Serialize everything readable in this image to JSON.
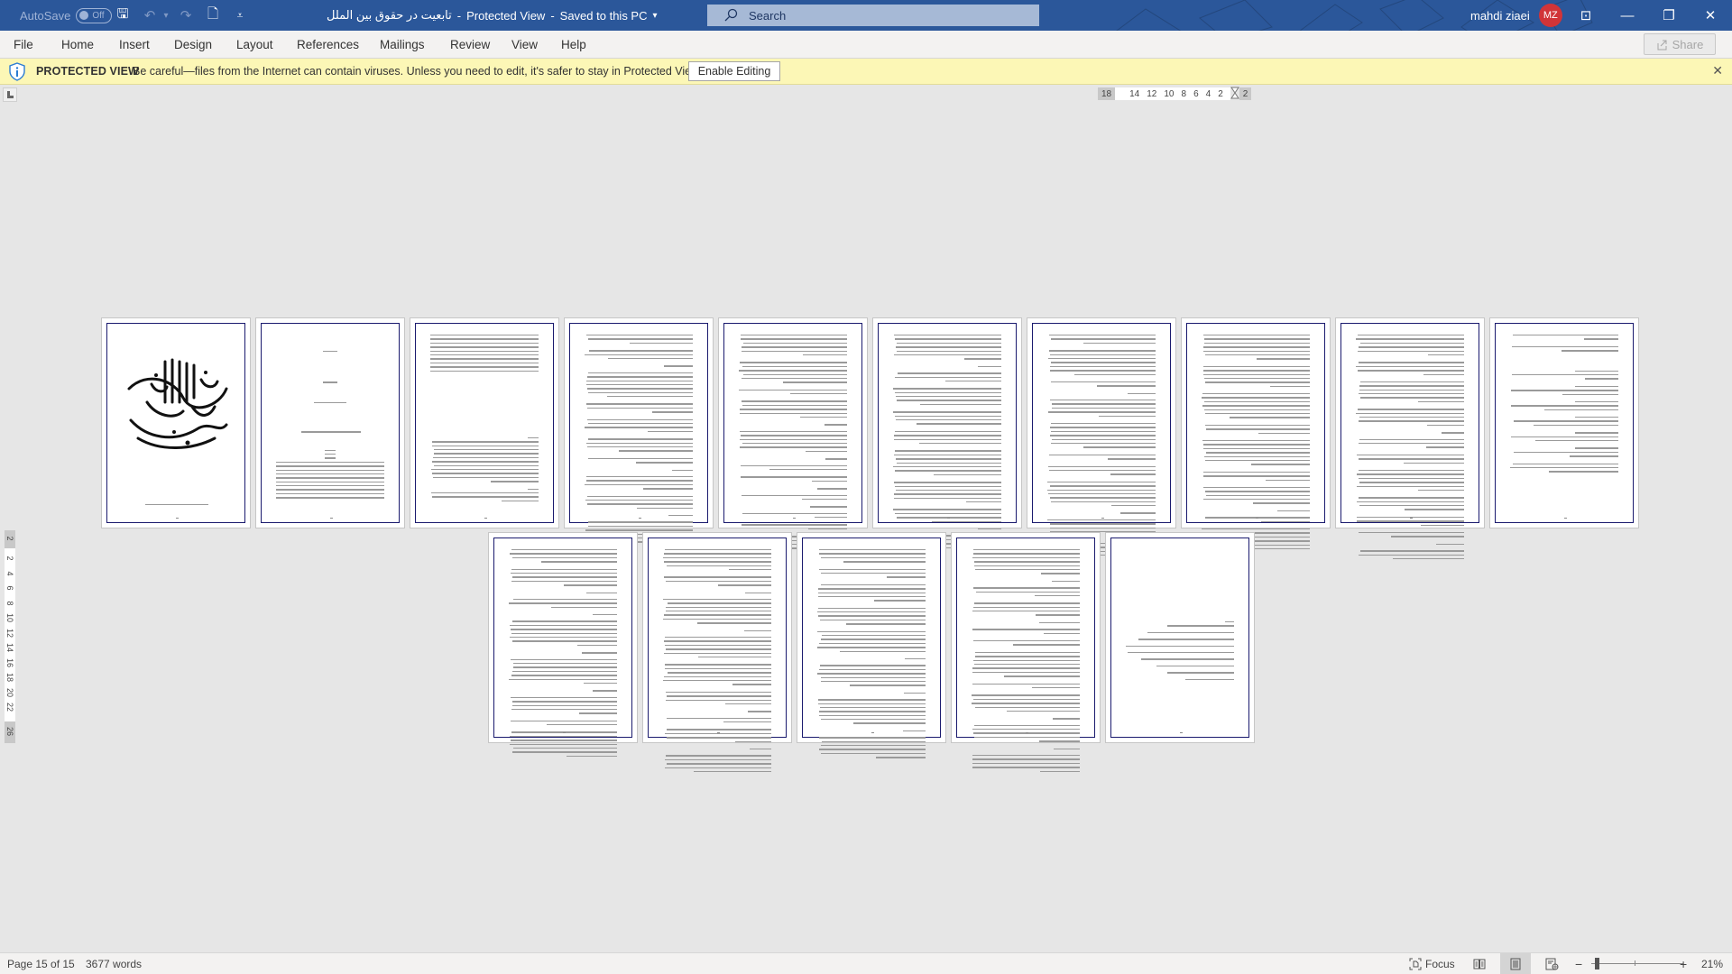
{
  "titlebar": {
    "autosave_label": "AutoSave",
    "autosave_state": "Off",
    "qat": [
      {
        "icon": "save-icon",
        "glyph": "🖫"
      },
      {
        "icon": "undo-icon",
        "glyph": "↶"
      },
      {
        "icon": "undo-dropdown-icon",
        "glyph": "▾"
      },
      {
        "icon": "redo-icon",
        "glyph": "↷"
      },
      {
        "icon": "new-document-icon",
        "glyph": "🗋"
      },
      {
        "icon": "customize-qat-icon",
        "glyph": "⩡"
      }
    ],
    "doc_name": "تابعیت در حقوق بین الملل",
    "separator": "-",
    "mode": "Protected View",
    "save_status": "Saved to this PC",
    "save_status_caret": "▾",
    "search_placeholder": "Search",
    "user_name": "mahdi ziaei",
    "user_initials": "MZ",
    "window_buttons": {
      "ribbon_display": "⊡",
      "minimize": "—",
      "restore": "❐",
      "close": "✕"
    }
  },
  "ribbon": {
    "tabs": [
      "File",
      "Home",
      "Insert",
      "Design",
      "Layout",
      "References",
      "Mailings",
      "Review",
      "View",
      "Help"
    ],
    "share_label": "Share"
  },
  "protected_view": {
    "label": "PROTECTED VIEW",
    "message": "Be careful—files from the Internet can contain viruses. Unless you need to edit, it's safer to stay in Protected View.",
    "button": "Enable Editing",
    "close": "✕"
  },
  "rulers": {
    "horizontal_left_margin": "18",
    "horizontal_ticks": [
      "14",
      "12",
      "10",
      "8",
      "6",
      "4",
      "2"
    ],
    "horizontal_right_margin": "2",
    "vertical_top_margin": "2",
    "vertical_ticks": [
      "2",
      "4",
      "6",
      "8",
      "10",
      "12",
      "14",
      "16",
      "18",
      "20",
      "22"
    ],
    "vertical_bottom_margin": "26"
  },
  "document": {
    "page_count": 15,
    "pages_row1": 10,
    "pages_row2": 5
  },
  "statusbar": {
    "page_info": "Page 15 of 15",
    "word_count": "3677 words",
    "focus_label": "Focus",
    "zoom_minus": "−",
    "zoom_plus": "+",
    "zoom_level": "21%",
    "zoom_fraction": 0.21
  }
}
